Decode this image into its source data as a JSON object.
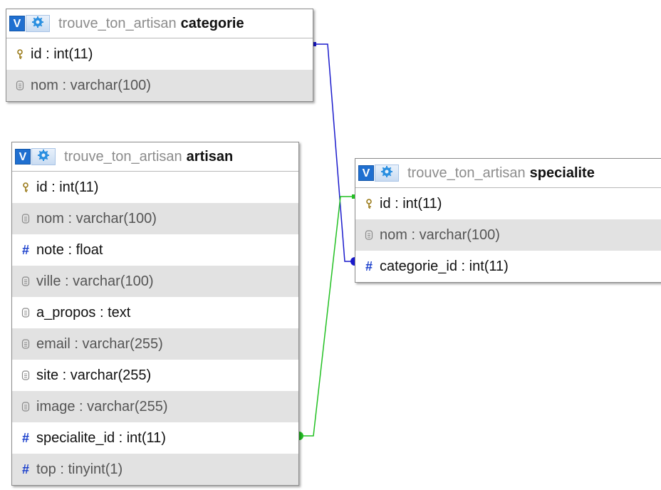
{
  "database": "trouve_ton_artisan",
  "tables": {
    "categorie": {
      "name": "categorie",
      "columns": [
        {
          "label": "id : int(11)",
          "type": "key"
        },
        {
          "label": "nom : varchar(100)",
          "type": "text"
        }
      ]
    },
    "artisan": {
      "name": "artisan",
      "columns": [
        {
          "label": "id : int(11)",
          "type": "key"
        },
        {
          "label": "nom : varchar(100)",
          "type": "text"
        },
        {
          "label": "note : float",
          "type": "number"
        },
        {
          "label": "ville : varchar(100)",
          "type": "text"
        },
        {
          "label": "a_propos : text",
          "type": "text"
        },
        {
          "label": "email : varchar(255)",
          "type": "text"
        },
        {
          "label": "site : varchar(255)",
          "type": "text"
        },
        {
          "label": "image : varchar(255)",
          "type": "text"
        },
        {
          "label": "specialite_id : int(11)",
          "type": "number"
        },
        {
          "label": "top : tinyint(1)",
          "type": "number"
        }
      ]
    },
    "specialite": {
      "name": "specialite",
      "columns": [
        {
          "label": "id : int(11)",
          "type": "key"
        },
        {
          "label": "nom : varchar(100)",
          "type": "text"
        },
        {
          "label": "categorie_id : int(11)",
          "type": "number"
        }
      ]
    }
  },
  "buttons": {
    "toggle_label": "V"
  },
  "relations": [
    {
      "from": "specialite.categorie_id",
      "to": "categorie.id",
      "color": "#1a1acc"
    },
    {
      "from": "artisan.specialite_id",
      "to": "specialite.id",
      "color": "#22c022"
    }
  ],
  "icons": {
    "key": "key-icon",
    "text": "text-column-icon",
    "number": "hash-icon",
    "options": "gear-icon"
  },
  "colors": {
    "header_button": "#1f6fd0",
    "row_alt": "#e2e2e2",
    "fk_categorie": "#1a1acc",
    "fk_specialite": "#22c022"
  }
}
